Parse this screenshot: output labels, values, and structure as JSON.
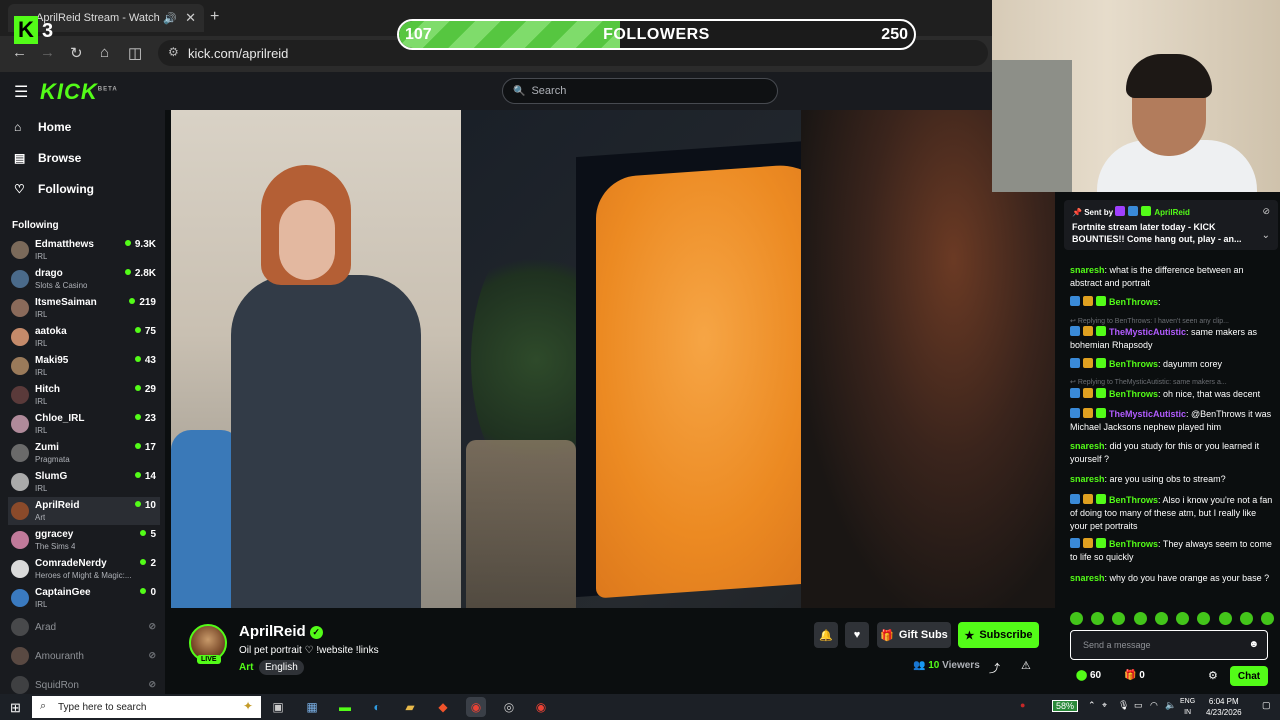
{
  "browser": {
    "tab_title": "AprilReid Stream - Watch Live on",
    "url": "kick.com/aprilreid"
  },
  "overlay": {
    "badge_count": "3",
    "followers_current": "107",
    "followers_label": "FOLLOWERS",
    "followers_goal": "250",
    "followers_progress": 0.43
  },
  "header": {
    "logo": "KICK",
    "logo_beta": "BETA",
    "search_placeholder": "Search"
  },
  "sidebar": {
    "nav": [
      {
        "label": "Home",
        "icon": "home-icon"
      },
      {
        "label": "Browse",
        "icon": "browse-icon"
      },
      {
        "label": "Following",
        "icon": "heart-icon"
      }
    ],
    "following_heading": "Following",
    "channels": [
      {
        "name": "Edmatthews",
        "category": "IRL",
        "viewers": "9.3K",
        "color": "#7b6a5a"
      },
      {
        "name": "drago",
        "category": "Slots & Casino",
        "viewers": "2.8K",
        "color": "#4a6a8a"
      },
      {
        "name": "ItsmeSaiman",
        "category": "IRL",
        "viewers": "219",
        "color": "#8a6a5a"
      },
      {
        "name": "aatoka",
        "category": "IRL",
        "viewers": "75",
        "color": "#c48a6a"
      },
      {
        "name": "Maki95",
        "category": "IRL",
        "viewers": "43",
        "color": "#9a7a5a"
      },
      {
        "name": "Hitch",
        "category": "IRL",
        "viewers": "29",
        "color": "#5a3a3a"
      },
      {
        "name": "Chloe_IRL",
        "category": "IRL",
        "viewers": "23",
        "color": "#b08a9a"
      },
      {
        "name": "Zumi",
        "category": "Pragmata",
        "viewers": "17",
        "color": "#6a6a6a"
      },
      {
        "name": "SlumG",
        "category": "IRL",
        "viewers": "14",
        "color": "#aaaaaa"
      },
      {
        "name": "AprilReid",
        "category": "Art",
        "viewers": "10",
        "color": "#8a4a2a"
      },
      {
        "name": "ggracey",
        "category": "The Sims 4",
        "viewers": "5",
        "color": "#c07a9a"
      },
      {
        "name": "ComradeNerdy",
        "category": "Heroes of Might & Magic:...",
        "viewers": "2",
        "color": "#dadada"
      },
      {
        "name": "CaptainGee",
        "category": "IRL",
        "viewers": "0",
        "color": "#3a7ac0"
      }
    ],
    "offline": [
      {
        "name": "Arad",
        "color": "#777"
      },
      {
        "name": "Amouranth",
        "color": "#997766"
      },
      {
        "name": "SquidRon",
        "color": "#666"
      }
    ]
  },
  "stream": {
    "streamer": "AprilReid",
    "live_label": "LIVE",
    "title": "Oil pet portrait ♡ !website !links",
    "category": "Art",
    "tag": "English",
    "gift_subs": "Gift Subs",
    "subscribe": "Subscribe",
    "viewers_count": "10",
    "viewers_label": "Viewers"
  },
  "chat": {
    "pinned_sent_by": "Sent by",
    "pinned_user": "AprilReid",
    "pinned_message": "Fortnite stream later today - KICK BOUNTIES!! Come hang out, play - an...",
    "messages": [
      {
        "user": "snaresh",
        "color": "#53fc18",
        "text": ": what is the difference between an abstract and portrait",
        "badges": 0
      },
      {
        "user": "BenThrows",
        "color": "#53fc18",
        "text": ":",
        "badges": 3
      },
      {
        "reply": "Replying to BenThrows: I haven't seen any clip..."
      },
      {
        "user": "TheMysticAutistic",
        "color": "#b25cff",
        "text": ": same makers as bohemian Rhapsody",
        "badges": 3
      },
      {
        "user": "BenThrows",
        "color": "#53fc18",
        "text": ": dayumm corey",
        "badges": 3
      },
      {
        "reply": "Replying to TheMysticAutistic: same makers a..."
      },
      {
        "user": "BenThrows",
        "color": "#53fc18",
        "text": ": oh nice, that was decent",
        "badges": 3
      },
      {
        "user": "TheMysticAutistic",
        "color": "#b25cff",
        "text": ": @BenThrows it was Michael Jacksons nephew played him",
        "badges": 3
      },
      {
        "user": "snaresh",
        "color": "#53fc18",
        "text": ": did you study for this or you learned it yourself ?",
        "badges": 0
      },
      {
        "user": "snaresh",
        "color": "#53fc18",
        "text": ": are you using obs to stream?",
        "badges": 0
      },
      {
        "user": "BenThrows",
        "color": "#53fc18",
        "text": ": Also i know you're not a fan of doing too many of these atm, but I really like your pet portraits",
        "badges": 3
      },
      {
        "user": "BenThrows",
        "color": "#53fc18",
        "text": ": They always seem to come to life so quickly",
        "badges": 3
      },
      {
        "user": "snaresh",
        "color": "#53fc18",
        "text": ": why do you have orange as your base ?",
        "badges": 0
      }
    ],
    "input_placeholder": "Send a message",
    "points": "60",
    "gifts": "0",
    "send_label": "Chat"
  },
  "taskbar": {
    "search_placeholder": "Type here to search",
    "battery": "58%",
    "lang_top": "ENG",
    "lang_bottom": "IN",
    "time": "6:04 PM",
    "date": "4/23/2026"
  }
}
